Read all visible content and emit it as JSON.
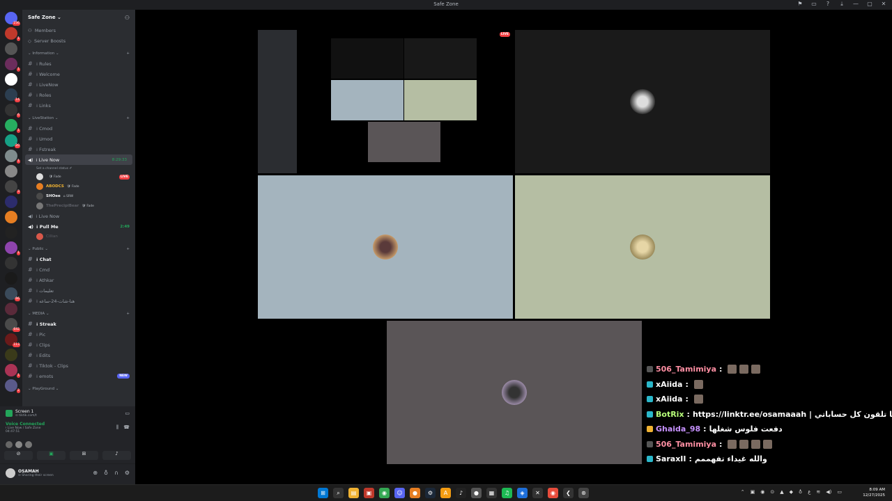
{
  "window": {
    "title": "Safe Zone",
    "controls": [
      "⚑",
      "▭",
      "?",
      "⤓",
      "—",
      "▢",
      "✕"
    ]
  },
  "servers": [
    {
      "color": "#5865f2",
      "badge": "236"
    },
    {
      "color": "#c0392b",
      "badge": "1"
    },
    {
      "color": "#555"
    },
    {
      "color": "#6b2d5c",
      "badge": "1"
    },
    {
      "color": "#ffffff"
    },
    {
      "color": "#2c3e50",
      "badge": "14"
    },
    {
      "color": "#333",
      "badge": "6"
    },
    {
      "color": "#27ae60",
      "badge": "1"
    },
    {
      "color": "#16a085",
      "badge": "20"
    },
    {
      "color": "#7f8c8d",
      "badge": "1"
    },
    {
      "color": "#888"
    },
    {
      "color": "#444",
      "badge": "3"
    },
    {
      "color": "#2c2c6c"
    },
    {
      "color": "#e67e22"
    },
    {
      "color": "#222"
    },
    {
      "color": "#8e44ad",
      "badge": "1"
    },
    {
      "color": "#333"
    },
    {
      "color": "#1a1a1a"
    },
    {
      "color": "#3a4a5a",
      "badge": "66"
    },
    {
      "color": "#5a2a3a"
    },
    {
      "color": "#4a4a4a",
      "badge": "642"
    },
    {
      "color": "#6a1a1a",
      "badge": "113"
    },
    {
      "color": "#3a3a1a"
    },
    {
      "color": "#aa3355",
      "badge": "1"
    },
    {
      "color": "#5a5a8a",
      "badge": "2"
    }
  ],
  "guild": {
    "name": "Safe Zone ⌄"
  },
  "top_links": [
    "Members",
    "Server Boosts"
  ],
  "categories": {
    "information": "⌄ Information ⌄",
    "livestation": "⌄ LiveStation ⌄",
    "public": "⌄ Public ⌄",
    "media": "⌄ MEDIA ⌄",
    "playground": "⌄ PlayGround ⌄"
  },
  "info_channels": [
    "⁞ Rules",
    "⁞ Welcome",
    "⁞ LiveNow",
    "⁞ Roles",
    "⁞ Links"
  ],
  "live_text_channels": [
    "⁞ Cmod",
    "⁞ Umod",
    "⁞ Fstreak"
  ],
  "live_now": {
    "name": "⁞ Live Now",
    "time": "8:29:33",
    "status": "Set a channel status ✐"
  },
  "voice_users": [
    {
      "name": "",
      "tag": "🛡 Fade",
      "color": "#fff",
      "live": "LIVE"
    },
    {
      "name": "ABODCS",
      "tag": "🛡 Fade",
      "color": "#f0b232"
    },
    {
      "name": "SHOee",
      "tag": "⌂ SRW",
      "color": "#f2f3f5"
    },
    {
      "name": "ThePrecipiBear",
      "tag": "🛡 Fade",
      "color": "#5c5e66"
    }
  ],
  "live_now2": "⁞ Live Now",
  "pull_me": {
    "name": "⁞ Pull Me",
    "time": "2:49",
    "user": "Cillian"
  },
  "public_channels": [
    "⁞ Chat",
    "⁞ Cmd",
    "⁞ Athkar",
    "⁞ تعليمات",
    "⁞ هنا-شات-24-ساعه"
  ],
  "media_channels": [
    "⁞ Streak",
    "⁞ Pic",
    "⁞ Clips",
    "⁞ Edits",
    "⁞ Tiktok - Clips",
    "⁞ emots"
  ],
  "new_badge": "NEW",
  "screen_share": {
    "title": "Screen 1",
    "sub": "⊙ tiktik.com/t"
  },
  "voice": {
    "status": "Voice Connected",
    "channel": "⁞ Live Now / Safe Zone",
    "time": "04:47:51"
  },
  "user": {
    "name": "OSAMAH",
    "status": "⊙ Sharing their screen"
  },
  "stage_colors": {
    "tile1": "#000000",
    "tile2": "#1a1a1a",
    "tile3": "#a4b4be",
    "tile4": "#b5bea3",
    "tile5": "#5a5557"
  },
  "chat": [
    {
      "user": "506_Tamimiya",
      "sep": " :",
      "msg": "",
      "ucolor": "#ff8fa3",
      "emotes": 3
    },
    {
      "user": "xAiida",
      "sep": " :",
      "msg": "",
      "ucolor": "#ffffff",
      "emotes": 1
    },
    {
      "user": "xAiida",
      "sep": " :",
      "msg": "",
      "ucolor": "#ffffff",
      "emotes": 1
    },
    {
      "user": "BotRix",
      "sep": " :",
      "msg": "https://linktr.ee/osamaaah | هنا تلقون كل حساباتي",
      "ucolor": "#b8ff7a",
      "emotes": 0
    },
    {
      "user": "Ghaida_98",
      "sep": " :",
      "msg": "دفعت فلوس شغلها",
      "ucolor": "#c792ff",
      "emotes": 0
    },
    {
      "user": "506_Tamimiya",
      "sep": " :",
      "msg": "",
      "ucolor": "#ff8fa3",
      "emotes": 4
    },
    {
      "user": "SaraxII",
      "sep": " :",
      "msg": "والله غيداء تفهممم",
      "ucolor": "#ffffff",
      "emotes": 0
    }
  ],
  "taskbar": {
    "icons": [
      {
        "name": "windows-start-icon",
        "glyph": "⊞",
        "color": "#0078d4"
      },
      {
        "name": "search-icon",
        "glyph": "⌕",
        "color": "#333"
      },
      {
        "name": "file-explorer-icon",
        "glyph": "▤",
        "color": "#f0b232"
      },
      {
        "name": "app-red-icon",
        "glyph": "▣",
        "color": "#c0392b"
      },
      {
        "name": "chrome-icon",
        "glyph": "◉",
        "color": "#34a853"
      },
      {
        "name": "discord-icon",
        "glyph": "☺",
        "color": "#5865f2"
      },
      {
        "name": "app-orange-icon",
        "glyph": "●",
        "color": "#e67e22"
      },
      {
        "name": "steam-icon",
        "glyph": "⚙",
        "color": "#1b2838"
      },
      {
        "name": "app-a-icon",
        "glyph": "A",
        "color": "#f39c12"
      },
      {
        "name": "app-tiktok-icon",
        "glyph": "♪",
        "color": "#222"
      },
      {
        "name": "app-gray-icon",
        "glyph": "●",
        "color": "#555"
      },
      {
        "name": "app-qr-icon",
        "glyph": "▦",
        "color": "#333"
      },
      {
        "name": "spotify-icon",
        "glyph": "♫",
        "color": "#1db954"
      },
      {
        "name": "app-blue-icon",
        "glyph": "◈",
        "color": "#1e6fd9"
      },
      {
        "name": "app-x-icon",
        "glyph": "✕",
        "color": "#333"
      },
      {
        "name": "app-red2-icon",
        "glyph": "◉",
        "color": "#e74c3c"
      },
      {
        "name": "app-arrow-icon",
        "glyph": "❮",
        "color": "#333"
      },
      {
        "name": "app-circle-icon",
        "glyph": "⊛",
        "color": "#444"
      }
    ],
    "time": "8:09 AM",
    "date": "12/27/2025"
  }
}
